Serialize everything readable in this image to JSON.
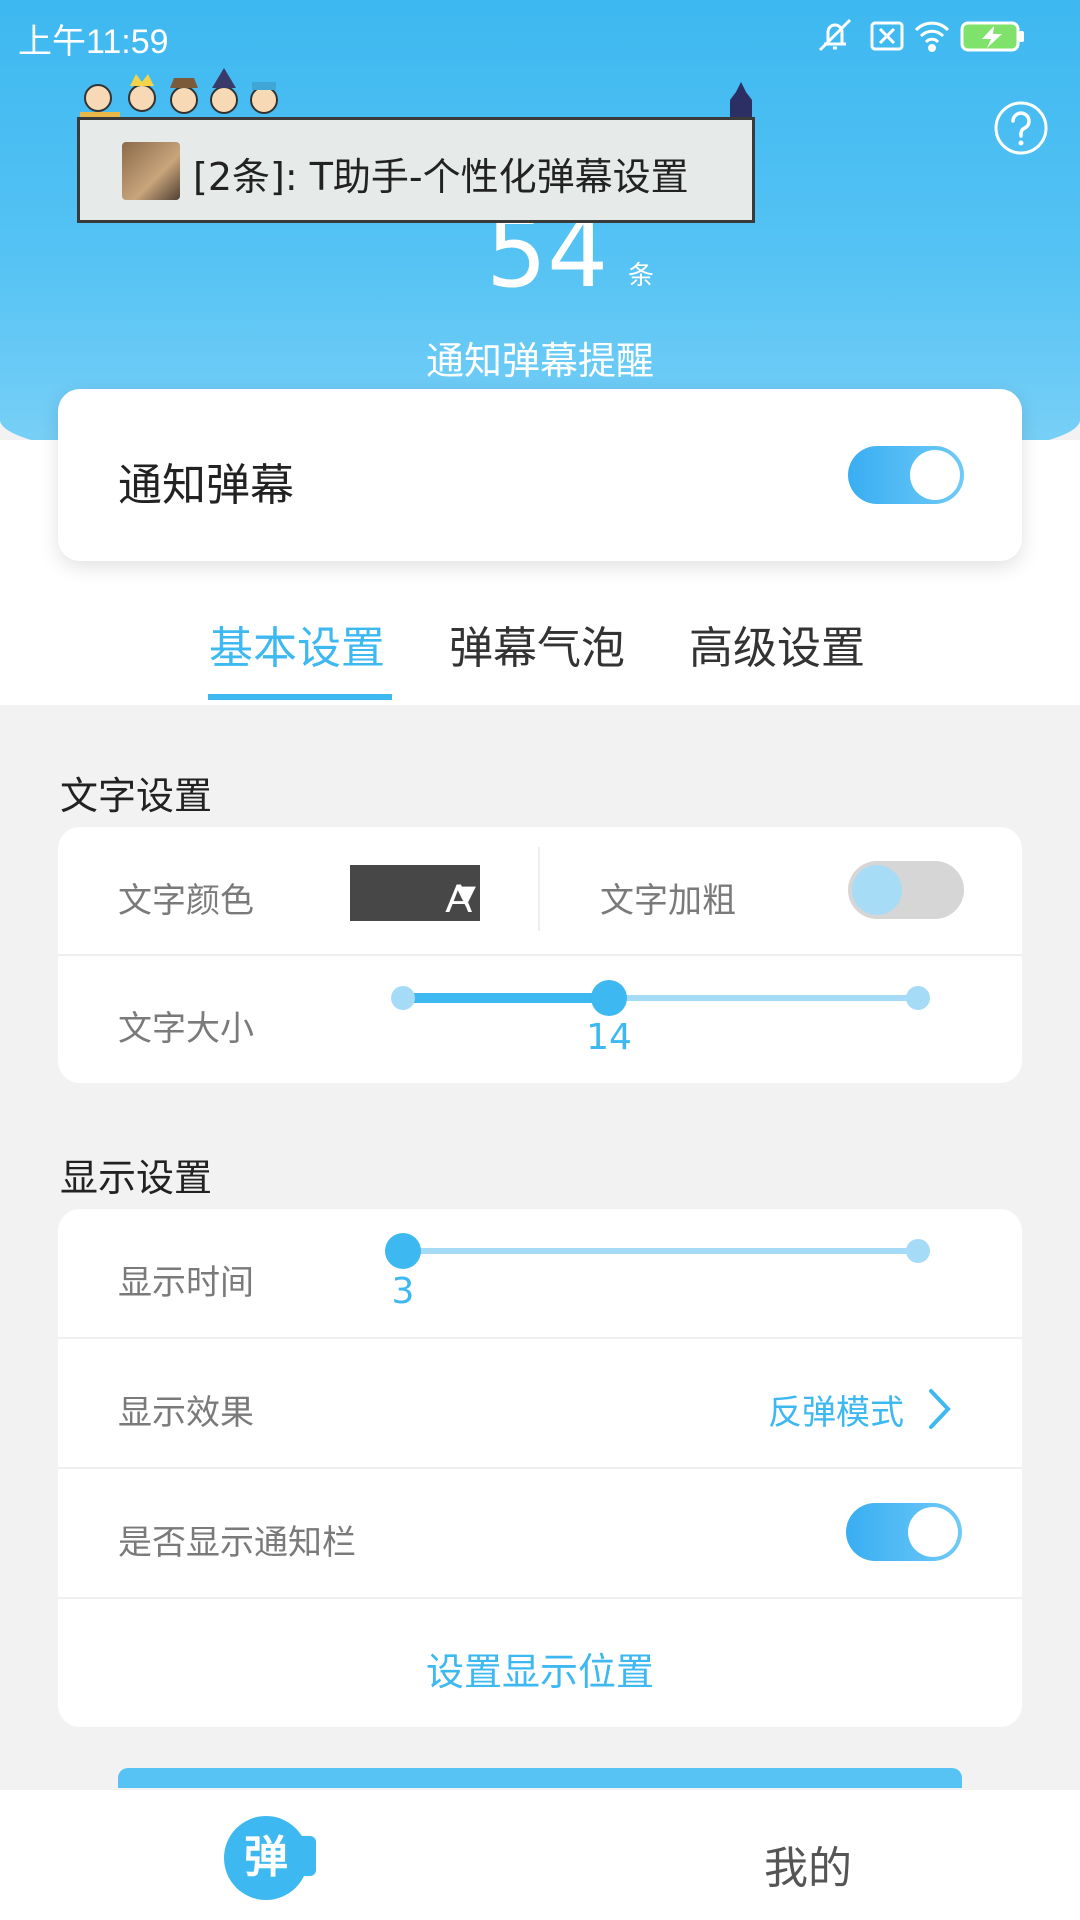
{
  "status_bar": {
    "time": "上午11:59",
    "icons": [
      "mute-bell-icon",
      "sim-x-icon",
      "wifi-icon",
      "battery-charging-icon"
    ]
  },
  "header": {
    "notification_text": "[2条]: T助手-个性化弹幕设置",
    "count": "54",
    "count_unit": "条",
    "subtitle": "通知弹幕提醒"
  },
  "main_toggle": {
    "label": "通知弹幕",
    "on": true
  },
  "tabs": [
    {
      "label": "基本设置",
      "active": true
    },
    {
      "label": "弹幕气泡",
      "active": false
    },
    {
      "label": "高级设置",
      "active": false
    }
  ],
  "text_settings": {
    "title": "文字设置",
    "color_label": "文字颜色",
    "color_preview_text": "A",
    "color_preview_bg": "#474747",
    "bold_label": "文字加粗",
    "bold_on": false,
    "size_label": "文字大小",
    "size_value": "14",
    "size_fraction": 0.4
  },
  "display_settings": {
    "title": "显示设置",
    "time_label": "显示时间",
    "time_value": "3",
    "time_fraction": 0.0,
    "effect_label": "显示效果",
    "effect_value": "反弹模式",
    "notification_bar_label": "是否显示通知栏",
    "notification_bar_on": true,
    "position_link": "设置显示位置"
  },
  "bottom_nav": {
    "home_logo_text": "弹",
    "mine_label": "我的"
  },
  "colors": {
    "accent": "#3db8f0",
    "track_light": "#a6dbf7"
  }
}
